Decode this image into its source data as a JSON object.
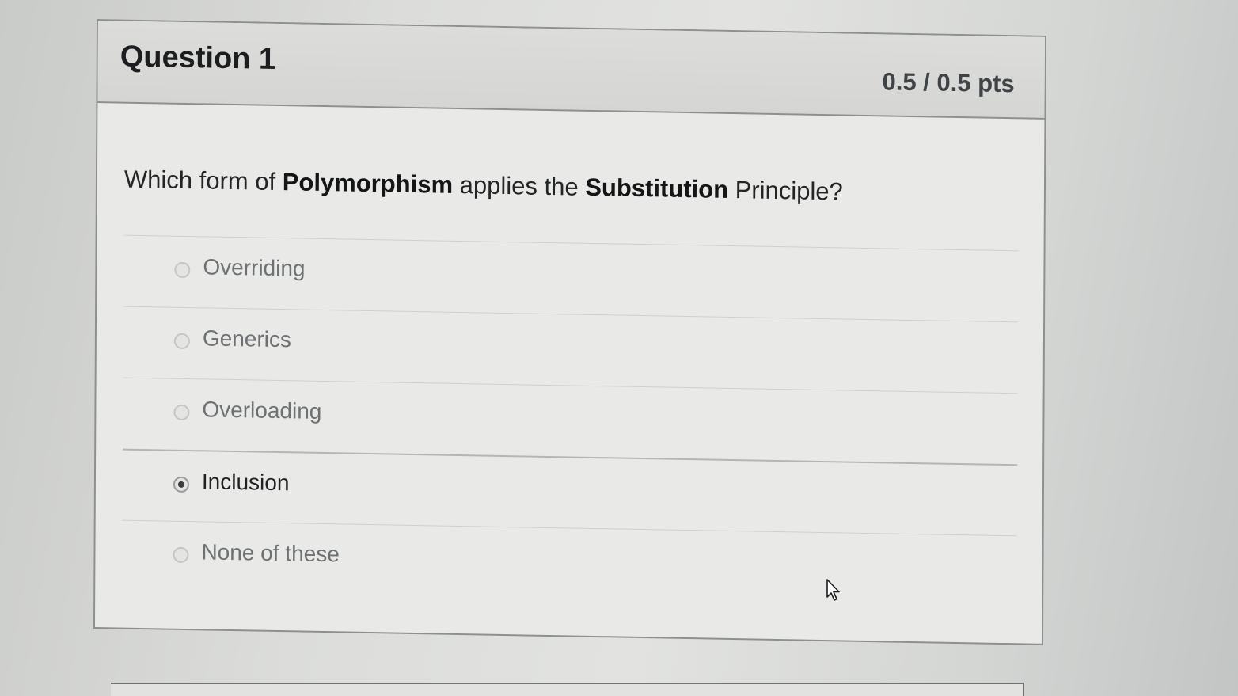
{
  "question": {
    "title": "Question 1",
    "points": "0.5 / 0.5 pts",
    "text_parts": [
      "Which form of ",
      "Polymorphism",
      " applies the ",
      "Substitution",
      " Principle?"
    ]
  },
  "answers": [
    {
      "label": "Overriding",
      "selected": false
    },
    {
      "label": "Generics",
      "selected": false
    },
    {
      "label": "Overloading",
      "selected": false
    },
    {
      "label": "Inclusion",
      "selected": true
    },
    {
      "label": "None of these",
      "selected": false
    }
  ],
  "icons": {
    "radio": "radio-button",
    "cursor": "mouse-pointer-icon"
  }
}
